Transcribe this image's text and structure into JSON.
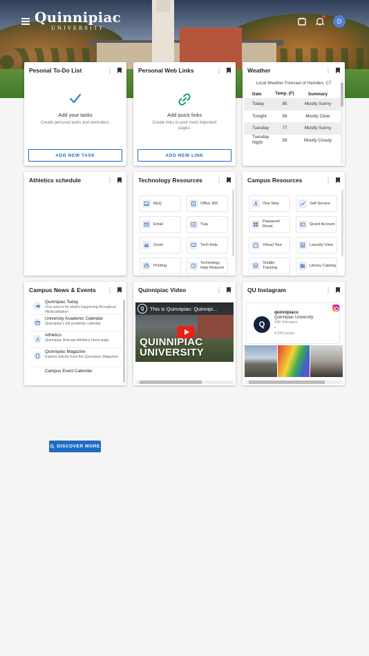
{
  "header": {
    "logo_main": "Quinnipiac",
    "logo_sub": "UNIVERSITY",
    "avatar_initial": "D"
  },
  "todo": {
    "title": "Pesonal To-Do List",
    "empty_title": "Add your tasks",
    "empty_desc": "Create personal tasks and reminders.",
    "button": "ADD NEW TASK"
  },
  "links": {
    "title": "Personal Web Links",
    "empty_title": "Add quick links",
    "empty_desc": "Create links to your most important pages.",
    "button": "ADD NEW LINK"
  },
  "weather": {
    "title": "Weather",
    "location": "Local Weather Forecast of Hamden, CT",
    "col_date": "Date",
    "col_temp": "Temp. (F)",
    "col_summary": "Summary",
    "rows": [
      {
        "date": "Today",
        "temp": "85",
        "summary": "Mostly Sunny"
      },
      {
        "date": "Tonight",
        "temp": "58",
        "summary": "Mostly Clear"
      },
      {
        "date": "Tuesday",
        "temp": "77",
        "summary": "Mostly Sunny"
      },
      {
        "date": "Tuesday Night",
        "temp": "59",
        "summary": "Mostly Cloudy"
      }
    ]
  },
  "athletics": {
    "title": "Athletics schedule"
  },
  "tech": {
    "title": "Technology Resources",
    "items": [
      "MyQ",
      "Office 365",
      "Email",
      "Yuja",
      "Zoom",
      "Tech Help",
      "Printing",
      "Technology Help Request"
    ]
  },
  "campus": {
    "title": "Campus Resources",
    "items": [
      "One Stop",
      "Self-Service",
      "Password Reset",
      "Qcard Account",
      "Virtual Tour",
      "Laundry View",
      "Shuttle Tracking",
      "Library Catalog"
    ]
  },
  "news": {
    "title": "Campus News & Events",
    "items": [
      {
        "title": "Quinnipiac Today",
        "desc": "Your source for what's happening throughout #BobcatNation"
      },
      {
        "title": "Univeristy Academic Calendar",
        "desc": "Quinnipiac's full academic calendar"
      },
      {
        "title": "Athletics",
        "desc": "Quinnipiac Bobcats Athletics home page"
      },
      {
        "title": "Quinnipiac Magazine",
        "desc": "Explore articles from the Quinnipiac Magazine"
      },
      {
        "title": "Campus Event Calendar",
        "desc": ""
      }
    ]
  },
  "video": {
    "title": "Quinnipiac Video",
    "video_title": "This is Quinnipiac: Quinnipi...",
    "overlay_line1": "QUINNIPIAC",
    "overlay_line2": "UNIVERSITY"
  },
  "instagram": {
    "title": "QU Instagram",
    "username": "quinnipiacu",
    "name": "Quinnipiac University",
    "followers": "44K followers",
    "posts": "4,593 posts"
  },
  "discover": {
    "label": "DISCOVER MORE"
  }
}
